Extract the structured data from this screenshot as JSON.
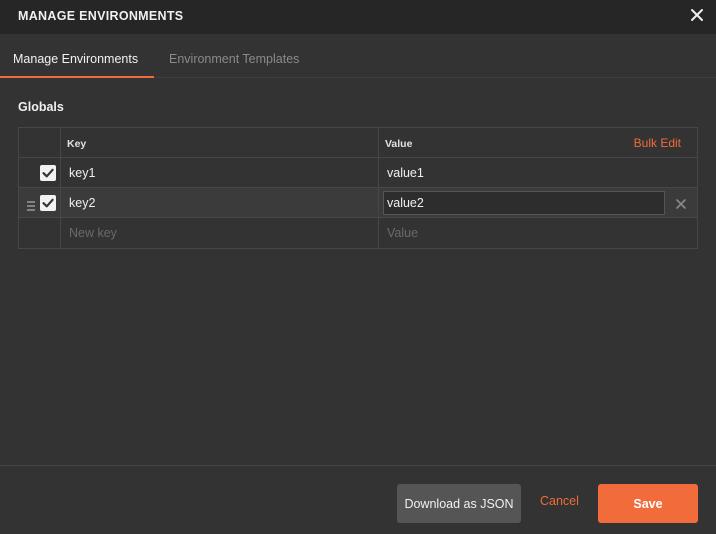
{
  "window": {
    "title": "MANAGE ENVIRONMENTS",
    "close_icon": "close-icon"
  },
  "tabs": [
    {
      "label": "Manage Environments",
      "active": true
    },
    {
      "label": "Environment Templates",
      "active": false
    }
  ],
  "globals": {
    "title": "Globals",
    "columns": {
      "key": "Key",
      "value": "Value",
      "bulk_edit": "Bulk Edit"
    },
    "rows": [
      {
        "enabled": true,
        "key": "key1",
        "value": "value1"
      },
      {
        "enabled": true,
        "key": "key2",
        "value": "value2"
      }
    ],
    "new_row": {
      "key_placeholder": "New key",
      "value_placeholder": "Value"
    }
  },
  "footer": {
    "download_label": "Download as JSON",
    "cancel_label": "Cancel",
    "save_label": "Save"
  },
  "colors": {
    "accent": "#f26b3a",
    "background": "#333333",
    "titlebar": "#262626"
  }
}
